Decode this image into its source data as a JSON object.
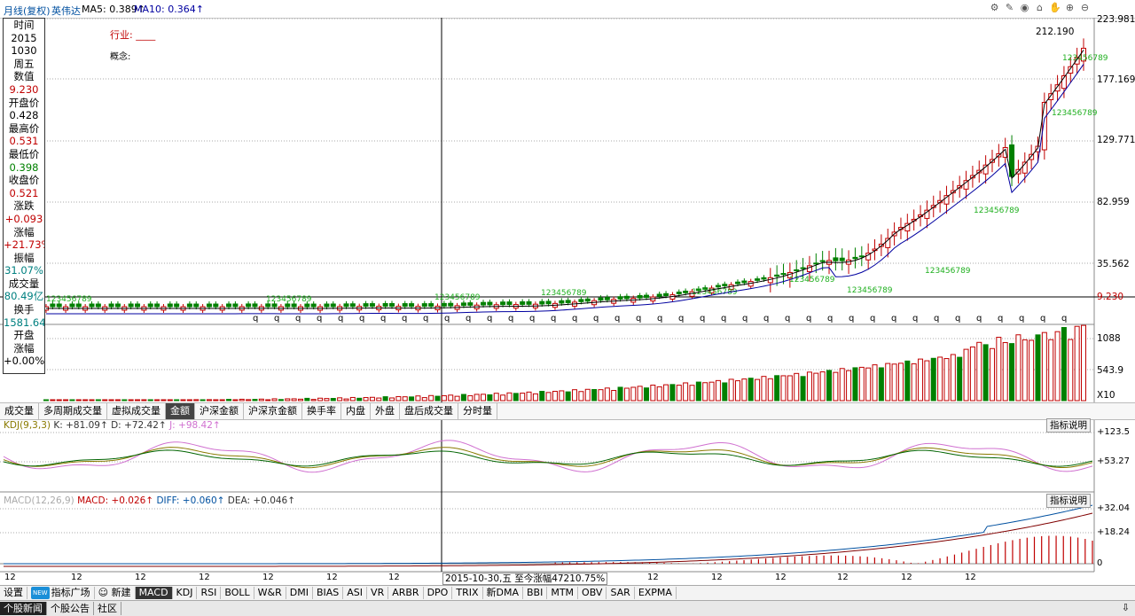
{
  "topbar": {
    "period": "月线(复权)",
    "stock": "英伟达",
    "ma5": "MA5: 0.389↑",
    "ma10": "MA10: 0.364↑",
    "icons": [
      "settings-icon",
      "pen-icon",
      "eye-icon",
      "basket-icon",
      "hand-icon",
      "zoom-in-icon",
      "zoom-out-icon"
    ]
  },
  "info_panel": [
    {
      "text": "时间",
      "cls": ""
    },
    {
      "text": "2015",
      "cls": ""
    },
    {
      "text": "1030",
      "cls": ""
    },
    {
      "text": "周五",
      "cls": ""
    },
    {
      "text": "数值",
      "cls": ""
    },
    {
      "text": "9.230",
      "cls": "red"
    },
    {
      "text": "开盘价",
      "cls": ""
    },
    {
      "text": "0.428",
      "cls": ""
    },
    {
      "text": "最高价",
      "cls": ""
    },
    {
      "text": "0.531",
      "cls": "red"
    },
    {
      "text": "最低价",
      "cls": ""
    },
    {
      "text": "0.398",
      "cls": "green"
    },
    {
      "text": "收盘价",
      "cls": ""
    },
    {
      "text": "0.521",
      "cls": "red"
    },
    {
      "text": "涨跌",
      "cls": ""
    },
    {
      "text": "+0.093",
      "cls": "red"
    },
    {
      "text": "涨幅",
      "cls": ""
    },
    {
      "text": "+21.73%",
      "cls": "red"
    },
    {
      "text": "振幅",
      "cls": ""
    },
    {
      "text": "31.07%",
      "cls": "cyan"
    },
    {
      "text": "成交量",
      "cls": ""
    },
    {
      "text": "80.49亿",
      "cls": "cyan"
    },
    {
      "text": "换手",
      "cls": ""
    },
    {
      "text": "1581.64%",
      "cls": "cyan"
    },
    {
      "text": "开盘",
      "cls": ""
    },
    {
      "text": "涨幅",
      "cls": ""
    },
    {
      "text": "+0.00%",
      "cls": ""
    }
  ],
  "industry_label": "行业: ____",
  "concept_label": "概念:",
  "price_axis": [
    "223.981",
    "177.169",
    "129.771",
    "82.959",
    "35.562",
    "9.230"
  ],
  "last_price_label": "212.190",
  "volume_axis": [
    "1088",
    "543.9",
    "X10"
  ],
  "volume_tabs": [
    "成交量",
    "多周期成交量",
    "虚拟成交量",
    "金额",
    "沪深金额",
    "沪深京金额",
    "换手率",
    "内盘",
    "外盘",
    "盘后成交量",
    "分时量"
  ],
  "volume_active_tab": "金额",
  "kdj": {
    "name": "KDJ(9,3,3)",
    "k": "K: +81.09↑",
    "d": "D: +72.42↑",
    "j": "J: +98.42↑",
    "axis": [
      "+123.5",
      "+53.27"
    ],
    "explain": "指标说明"
  },
  "macd": {
    "name": "MACD(12,26,9)",
    "macd": "MACD: +0.026↑",
    "diff": "DIFF: +0.060↑",
    "dea": "DEA: +0.046↑",
    "axis": [
      "+32.04",
      "+18.24",
      "0"
    ],
    "explain": "指标说明"
  },
  "date_axis": {
    "labels": [
      "12",
      "12",
      "12",
      "12",
      "12",
      "12",
      "12",
      "12",
      "12",
      "12",
      "12",
      "12",
      "12",
      "12"
    ],
    "cursor_label": "2015-10-30,五 至今涨幅47210.75%"
  },
  "bottom_bar": [
    "设置",
    "指标广场",
    "新建",
    "MACD",
    "KDJ",
    "RSI",
    "BOLL",
    "W&R",
    "DMI",
    "BIAS",
    "ASI",
    "VR",
    "ARBR",
    "DPO",
    "TRIX",
    "新DMA",
    "BBI",
    "MTM",
    "OBV",
    "SAR",
    "EXPMA"
  ],
  "bottom_active": "MACD",
  "bottom_new_badge": "NEW",
  "bottom_tabs": [
    "个股新闻",
    "个股公告",
    "社区"
  ],
  "bottom_tabs_active": "个股新闻",
  "colors": {
    "up": "#c00000",
    "down": "#008000",
    "ma5": "#000000",
    "ma10": "#0000a0",
    "k": "#8a7a00",
    "d": "#006400",
    "j": "#d070d0"
  },
  "chart_data": {
    "type": "candlestick",
    "price_ylim": [
      9.23,
      223.981
    ],
    "annotations": [
      "1",
      "2",
      "3",
      "4",
      "5",
      "6",
      "7",
      "8",
      "9"
    ],
    "last_close": 212.19
  }
}
